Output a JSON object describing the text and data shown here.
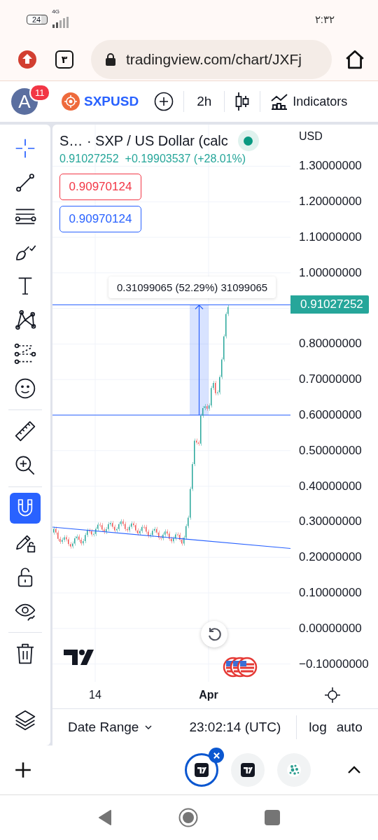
{
  "status_bar": {
    "battery": "24",
    "network": "4G",
    "time": "۲:۳۲"
  },
  "browser": {
    "tab_count": "۳",
    "url": "tradingview.com/chart/JXFj"
  },
  "toolbar": {
    "avatar": "A",
    "notifications": "11",
    "symbol": "SXPUSD",
    "interval": "2h",
    "indicators": "Indicators"
  },
  "tool_groups": [
    [
      {
        "kind": "crosshair",
        "active": true
      },
      {
        "kind": "trend_line",
        "active": false
      },
      {
        "kind": "fib",
        "active": false
      },
      {
        "kind": "brush",
        "active": false
      },
      {
        "kind": "text",
        "active": false
      },
      {
        "kind": "pattern",
        "active": false
      },
      {
        "kind": "forecast",
        "active": false
      },
      {
        "kind": "emoji",
        "active": false
      }
    ],
    [
      {
        "kind": "ruler",
        "active": false
      },
      {
        "kind": "zoom",
        "active": false
      }
    ],
    [
      {
        "kind": "magnet",
        "active": true
      },
      {
        "kind": "lock_drawings",
        "active": false
      },
      {
        "kind": "lock",
        "active": false
      },
      {
        "kind": "hide",
        "active": false
      }
    ],
    [
      {
        "kind": "trash",
        "active": false
      }
    ],
    [
      {
        "kind": "layers",
        "active": false
      }
    ]
  ],
  "legend": {
    "title": "S… · SXP / US Dollar (calc",
    "live": true,
    "price": "0.91027252",
    "change": "+0.19903537 (+28.01%)"
  },
  "trade_buttons": [
    {
      "kind": "sell",
      "price": "0.90970124"
    },
    {
      "kind": "buy",
      "price": "0.90970124"
    }
  ],
  "measure": {
    "label": "0.31099065 (52.29%) 31099065"
  },
  "price_axis": {
    "currency": "USD",
    "labels": [
      {
        "kind": "tick",
        "text": "1.30000000"
      },
      {
        "kind": "tick",
        "text": "1.20000000"
      },
      {
        "kind": "tick",
        "text": "1.10000000"
      },
      {
        "kind": "tick",
        "text": "1.00000000"
      },
      {
        "kind": "last_price",
        "text": "0.91027252"
      },
      {
        "kind": "tick",
        "text": "0.80000000"
      },
      {
        "kind": "tick",
        "text": "0.70000000"
      },
      {
        "kind": "tick",
        "text": "0.60000000"
      },
      {
        "kind": "tick",
        "text": "0.50000000"
      },
      {
        "kind": "tick",
        "text": "0.40000000"
      },
      {
        "kind": "tick",
        "text": "0.30000000"
      },
      {
        "kind": "tick",
        "text": "0.20000000"
      },
      {
        "kind": "tick",
        "text": "0.10000000"
      },
      {
        "kind": "tick",
        "text": "0.00000000"
      },
      {
        "kind": "tick",
        "text": "−0.10000000"
      }
    ]
  },
  "time_axis": [
    {
      "kind": "day",
      "text": "14"
    },
    {
      "kind": "month",
      "text": "Apr"
    }
  ],
  "bottom_bar": {
    "date_range": "Date Range",
    "time": "23:02:14 (UTC)",
    "log": "log",
    "auto": "auto"
  },
  "tabs": [
    {
      "kind": "tradingview",
      "selected": true
    },
    {
      "kind": "tradingview",
      "selected": false
    },
    {
      "kind": "site",
      "selected": false
    }
  ]
}
